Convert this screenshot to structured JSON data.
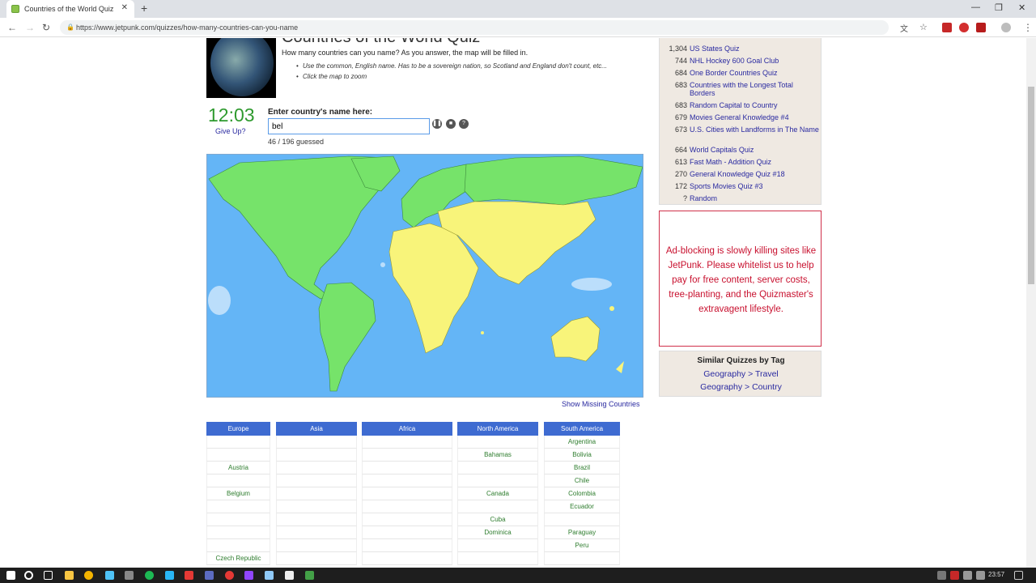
{
  "browser": {
    "tab_title": "Countries of the World Quiz",
    "url": "https://www.jetpunk.com/quizzes/how-many-countries-can-you-name",
    "new_tab_symbol": "+",
    "close_symbol": "✕"
  },
  "quiz": {
    "title": "Countries of the World Quiz",
    "intro": "How many countries can you name? As you answer, the map will be filled in.",
    "rules": [
      "Use the common, English name. Has to be a sovereign nation, so Scotland and England don't count, etc...",
      "Click the map to zoom"
    ],
    "timer": "12:03",
    "give_up": "Give Up?",
    "enter_label": "Enter country's name here:",
    "input_value": "bel",
    "guessed_text": "46 / 196 guessed",
    "show_missing": "Show Missing Countries"
  },
  "continents": [
    {
      "name": "Europe",
      "cells": [
        "",
        "",
        "Austria",
        "",
        "Belgium",
        "",
        "",
        "",
        "",
        "Czech Republic"
      ]
    },
    {
      "name": "Asia",
      "cells": [
        "",
        "",
        "",
        "",
        "",
        "",
        "",
        "",
        "",
        ""
      ]
    },
    {
      "name": "Africa",
      "cells": [
        "",
        "",
        "",
        "",
        "",
        "",
        "",
        "",
        "",
        ""
      ]
    },
    {
      "name": "North America",
      "cells": [
        "",
        "Bahamas",
        "",
        "",
        "Canada",
        "",
        "Cuba",
        "Dominica",
        "",
        ""
      ]
    },
    {
      "name": "South America",
      "cells": [
        "Argentina",
        "Bolivia",
        "Brazil",
        "Chile",
        "Colombia",
        "Ecuador",
        "",
        "Paraguay",
        "Peru",
        ""
      ]
    }
  ],
  "sidebar": {
    "items": [
      {
        "count": "1,304",
        "label": "US States Quiz"
      },
      {
        "count": "744",
        "label": "NHL Hockey 600 Goal Club"
      },
      {
        "count": "684",
        "label": "One Border Countries Quiz"
      },
      {
        "count": "683",
        "label": "Countries with the Longest Total Borders"
      },
      {
        "count": "683",
        "label": "Random Capital to Country"
      },
      {
        "count": "679",
        "label": "Movies General Knowledge #4"
      },
      {
        "count": "673",
        "label": "U.S. Cities with Landforms in The Name"
      },
      {
        "count": "664",
        "label": "World Capitals Quiz"
      },
      {
        "count": "613",
        "label": "Fast Math - Addition Quiz"
      },
      {
        "count": "270",
        "label": "General Knowledge Quiz #18"
      },
      {
        "count": "172",
        "label": "Sports Movies Quiz #3"
      },
      {
        "count": "?",
        "label": "Random"
      }
    ],
    "ad_text": "Ad-blocking is slowly killing sites like JetPunk. Please whitelist us to help pay for free content, server costs, tree-planting, and the Quizmaster's extravagent lifestyle.",
    "similar_title": "Similar Quizzes by Tag",
    "similar_links": [
      "Geography > Travel",
      "Geography > Country"
    ]
  },
  "taskbar": {
    "time": "23:57"
  },
  "colors": {
    "accent": "#3e6bd1",
    "timer": "#2e9a2e",
    "land_guessed": "#76e36a",
    "land_unguessed": "#f8f47a",
    "ocean": "#64b5f6"
  }
}
